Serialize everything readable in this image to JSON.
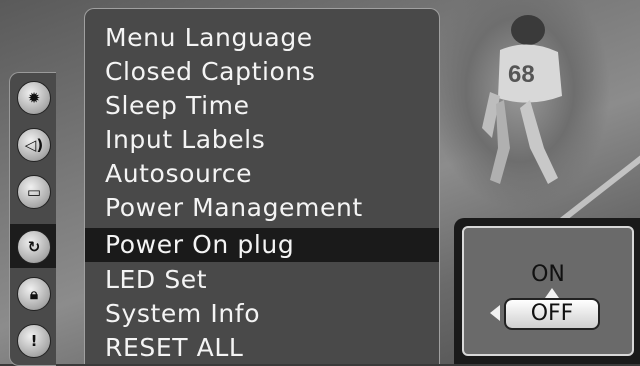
{
  "menu": {
    "items": [
      {
        "label": "Menu Language"
      },
      {
        "label": "Closed Captions"
      },
      {
        "label": "Sleep Time"
      },
      {
        "label": "Input Labels"
      },
      {
        "label": "Autosource"
      },
      {
        "label": "Power Management"
      },
      {
        "label": "Power On plug"
      },
      {
        "label": "LED Set"
      },
      {
        "label": "System Info"
      },
      {
        "label": "RESET ALL"
      }
    ],
    "selected_index": 6
  },
  "sidebar": {
    "icons": [
      {
        "name": "picture-icon"
      },
      {
        "name": "audio-icon"
      },
      {
        "name": "tv-icon"
      },
      {
        "name": "setup-icon"
      },
      {
        "name": "lock-icon"
      },
      {
        "name": "info-icon"
      }
    ],
    "active_index": 3
  },
  "option_panel": {
    "on_label": "ON",
    "off_label": "OFF",
    "selected": "OFF"
  },
  "background": {
    "jersey_number": "68"
  },
  "colors": {
    "menu_bg": "#494949",
    "selected_bg": "#1a1a1a",
    "text": "#f4f4f4"
  }
}
